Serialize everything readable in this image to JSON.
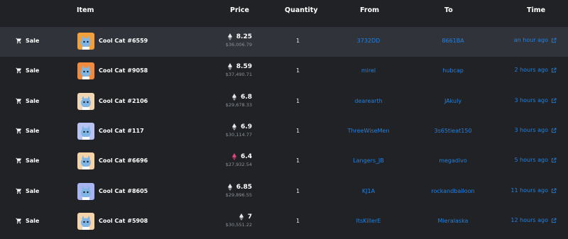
{
  "header": {
    "item": "Item",
    "price": "Price",
    "quantity": "Quantity",
    "from": "From",
    "to": "To",
    "time": "Time"
  },
  "colors": {
    "background": "#202225",
    "row_highlight": "#303339",
    "link": "#2081e2",
    "muted": "#8a939b"
  },
  "rows": [
    {
      "event": "Sale",
      "item": "Cool Cat #6559",
      "price": "8.25",
      "usd": "$36,006.79",
      "quantity": "1",
      "from": "3732DD",
      "to": "8661BA",
      "time": "an hour ago",
      "icon": "eth-icon",
      "avatar_bg": "#f3a03b"
    },
    {
      "event": "Sale",
      "item": "Cool Cat #9058",
      "price": "8.59",
      "usd": "$37,490.71",
      "quantity": "1",
      "from": "mirel",
      "to": "hubcap",
      "time": "2 hours ago",
      "icon": "eth-icon",
      "avatar_bg": "#f08a3c"
    },
    {
      "event": "Sale",
      "item": "Cool Cat #2106",
      "price": "6.8",
      "usd": "$29,678.33",
      "quantity": "1",
      "from": "dearearth",
      "to": "JAkuly",
      "time": "3 hours ago",
      "icon": "eth-icon",
      "avatar_bg": "#f2d6b3"
    },
    {
      "event": "Sale",
      "item": "Cool Cat #117",
      "price": "6.9",
      "usd": "$30,114.77",
      "quantity": "1",
      "from": "ThreeWiseMen",
      "to": "3s65tieat150",
      "time": "3 hours ago",
      "icon": "eth-icon",
      "avatar_bg": "#b9c3f2"
    },
    {
      "event": "Sale",
      "item": "Cool Cat #6696",
      "price": "6.4",
      "usd": "$27,932.54",
      "quantity": "1",
      "from": "Langers_JB",
      "to": "megadivo",
      "time": "5 hours ago",
      "icon": "weth-icon",
      "avatar_bg": "#f5d3a6"
    },
    {
      "event": "Sale",
      "item": "Cool Cat #8605",
      "price": "6.85",
      "usd": "$29,896.55",
      "quantity": "1",
      "from": "KJ1A",
      "to": "rockandballoon",
      "time": "11 hours ago",
      "icon": "eth-icon",
      "avatar_bg": "#a9b5f0"
    },
    {
      "event": "Sale",
      "item": "Cool Cat #5908",
      "price": "7",
      "usd": "$30,551.22",
      "quantity": "1",
      "from": "ItsKillerE",
      "to": "Mieralaska",
      "time": "12 hours ago",
      "icon": "eth-icon",
      "avatar_bg": "#f5d4ab"
    }
  ]
}
